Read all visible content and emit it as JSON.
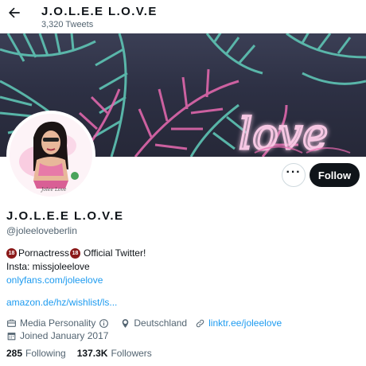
{
  "header": {
    "back_icon": "arrow-left-icon",
    "title": "J.O.L.E.E L.O.V.E",
    "tweet_count": "3,320 Tweets"
  },
  "banner": {
    "neon_text": "love",
    "colors": {
      "bg": "#2d3044",
      "leaf": "#5ec4b4",
      "pink": "#e96ab1"
    }
  },
  "avatar": {
    "signature": "Jolee Love"
  },
  "actions": {
    "more_label": "···",
    "follow_label": "Follow"
  },
  "profile": {
    "display_name": "J.O.L.E.E L.O.V.E",
    "handle": "@joleeloveberlin",
    "bio": {
      "badge": "18",
      "line1_a": "Pornactress",
      "line1_b": "Official Twitter!",
      "line2": "Insta: missjoleelove",
      "link1": "onlyfans.com/joleelove",
      "link2": "amazon.de/hz/wishlist/ls..."
    },
    "meta": {
      "category": "Media Personality",
      "location": "Deutschland",
      "website": "linktr.ee/joleelove",
      "joined": "Joined January 2017"
    },
    "stats": {
      "following_count": "285",
      "following_label": "Following",
      "followers_count": "137.3K",
      "followers_label": "Followers"
    }
  },
  "colors": {
    "accent": "#1d9bf0",
    "text": "#0f1419",
    "muted": "#536471"
  }
}
